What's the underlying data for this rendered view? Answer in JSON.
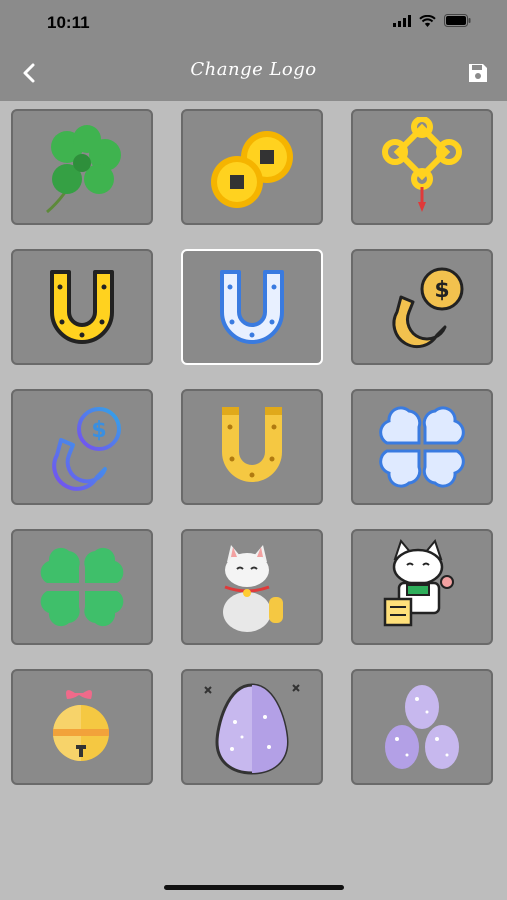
{
  "status_bar": {
    "time": "10:11"
  },
  "navbar": {
    "title": "Change Logo"
  },
  "logos": [
    {
      "icon": "four-leaf-clover-icon",
      "selected": false
    },
    {
      "icon": "gold-coins-icon",
      "selected": false
    },
    {
      "icon": "chinese-knot-icon",
      "selected": false
    },
    {
      "icon": "gold-horseshoe-icon",
      "selected": false
    },
    {
      "icon": "blue-horseshoe-icon",
      "selected": true
    },
    {
      "icon": "horseshoe-coin-icon",
      "selected": false
    },
    {
      "icon": "gradient-horseshoe-coin-icon",
      "selected": false
    },
    {
      "icon": "flat-gold-horseshoe-icon",
      "selected": false
    },
    {
      "icon": "blue-clover-icon",
      "selected": false
    },
    {
      "icon": "green-clover-icon",
      "selected": false
    },
    {
      "icon": "lucky-cat-icon",
      "selected": false
    },
    {
      "icon": "lucky-cat-cash-icon",
      "selected": false
    },
    {
      "icon": "bell-icon",
      "selected": false
    },
    {
      "icon": "purple-egg-icon",
      "selected": false
    },
    {
      "icon": "three-eggs-icon",
      "selected": false
    }
  ],
  "colors": {
    "bar": "#8b8b8b",
    "background": "#bdbdbd",
    "tile": "#8a8a8a",
    "selected_border": "#ffffff"
  }
}
